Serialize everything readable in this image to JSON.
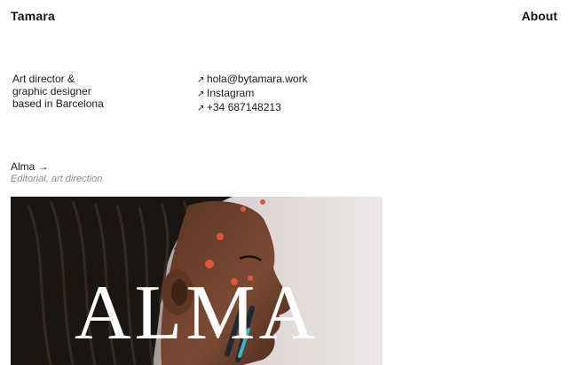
{
  "header": {
    "brand": "Tamara",
    "about_label": "About"
  },
  "bio": {
    "lines": [
      "Art director &",
      "graphic designer",
      "based in Barcelona"
    ]
  },
  "contacts": [
    {
      "icon": "arrow-up-right-icon",
      "label": "hola@bytamara.work"
    },
    {
      "icon": "arrow-up-right-icon",
      "label": "Instagram"
    },
    {
      "icon": "arrow-up-right-icon",
      "label": "+34 687148213"
    }
  ],
  "project": {
    "title": "Alma",
    "arrow": "→",
    "subtitle": "Editorial, art direction",
    "image_word": "ALMA"
  },
  "colors": {
    "text": "#1a1a1a",
    "muted": "#8a8a8a",
    "background": "#ffffff",
    "hero_background": "#e9e5e4"
  }
}
